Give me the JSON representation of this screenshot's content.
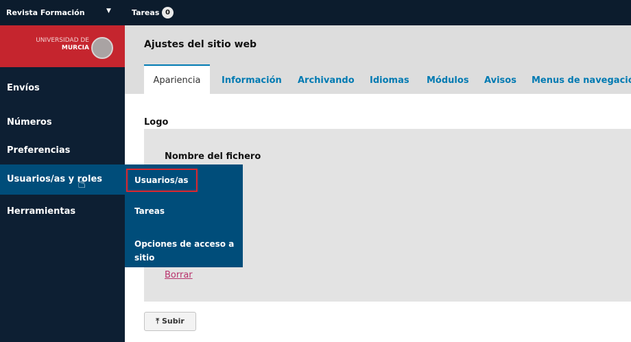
{
  "topbar": {
    "journal": "Revista Formación",
    "tasks_label": "Tareas",
    "tasks_count": "0"
  },
  "logo": {
    "line1": "UNIVERSIDAD DE",
    "line2": "MURCIA"
  },
  "sidebar": {
    "items": [
      {
        "label": "Envíos"
      },
      {
        "label": "Números"
      },
      {
        "label": "Preferencias"
      },
      {
        "label": "Usuarios/as y roles"
      },
      {
        "label": "Herramientas"
      }
    ]
  },
  "submenu": {
    "items": [
      {
        "label": "Usuarios/as"
      },
      {
        "label": "Tareas"
      },
      {
        "label": "Opciones de acceso a sitio"
      }
    ]
  },
  "main": {
    "title": "Ajustes del sitio web",
    "tabs": [
      {
        "label": "Apariencia"
      },
      {
        "label": "Información"
      },
      {
        "label": "Archivando"
      },
      {
        "label": "Idiomas"
      },
      {
        "label": "Módulos"
      },
      {
        "label": "Avisos"
      },
      {
        "label": "Menus de navegación"
      }
    ],
    "section_title": "Logo",
    "filename_label": "Nombre del fichero",
    "delete_link": "Borrar",
    "upload_button": "Subir"
  },
  "colors": {
    "topbar": "#0c1c2d",
    "sidebar": "#0d1f33",
    "logo_bg": "#c5252e",
    "active": "#004d7a",
    "link": "#007ab2",
    "delete_link": "#b8326c",
    "highlight": "#e0262d"
  },
  "icons": {
    "menu_caret": "caret-down-icon",
    "upload": "upload-icon",
    "cursor": "hand-pointer-icon"
  }
}
